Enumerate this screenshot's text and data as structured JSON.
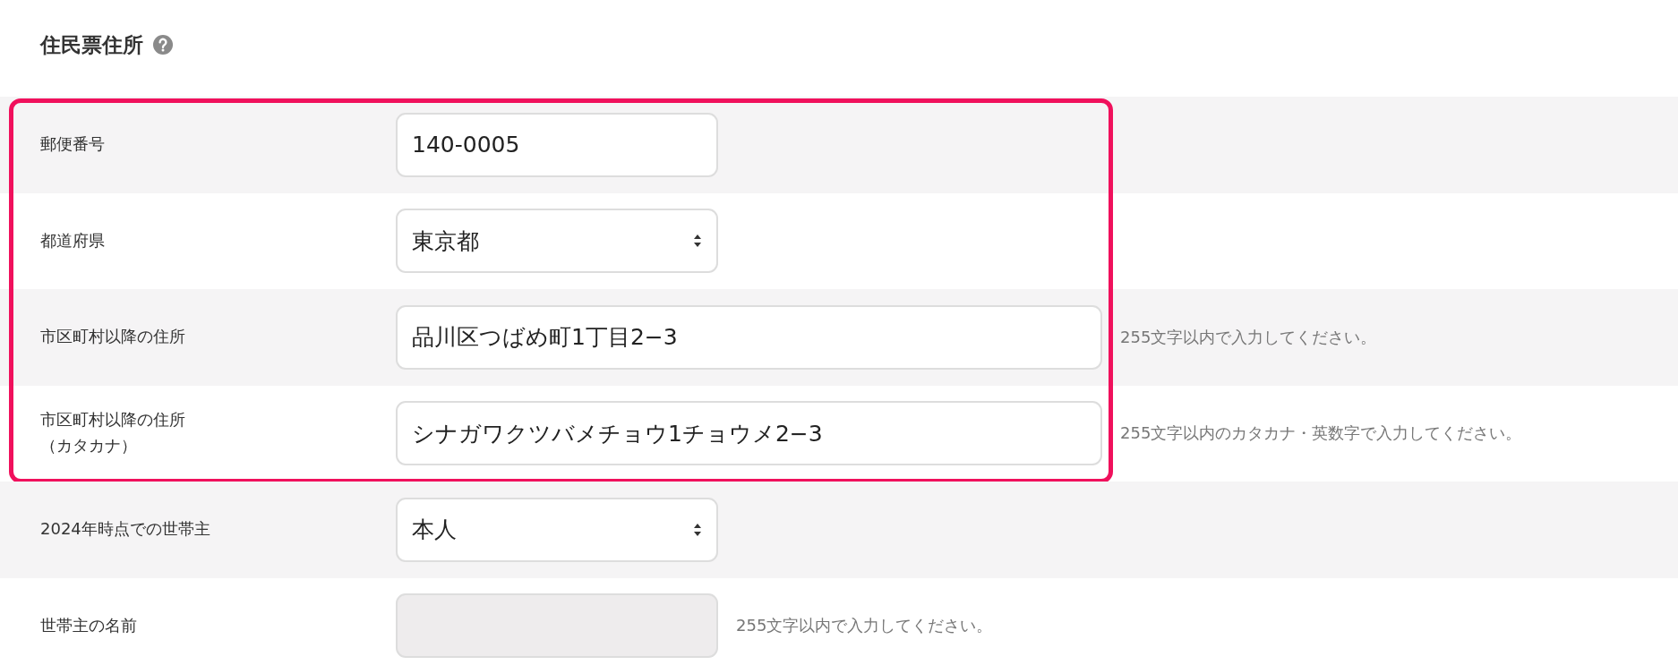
{
  "section": {
    "title": "住民票住所"
  },
  "rows": [
    {
      "label": "郵便番号",
      "kind": "text",
      "value": "140-0005",
      "highlighted": true
    },
    {
      "label": "都道府県",
      "kind": "select",
      "value": "東京都",
      "highlighted": true
    },
    {
      "label": "市区町村以降の住所",
      "kind": "wide-text",
      "value": "品川区つばめ町1丁目2−3",
      "hint": "255文字以内で入力してください。",
      "highlighted": true
    },
    {
      "label": "市区町村以降の住所",
      "sublabel": "（カタカナ）",
      "kind": "wide-text",
      "value": "シナガワクツバメチョウ1チョウメ2−3",
      "hint": "255文字以内のカタカナ・英数字で入力してください。",
      "highlighted": true
    },
    {
      "label": "2024年時点での世帯主",
      "kind": "select",
      "value": "本人",
      "highlighted": false
    },
    {
      "label": "世帯主の名前",
      "kind": "text",
      "disabled": true,
      "hint": "255文字以内で入力してください。",
      "highlighted": false
    }
  ]
}
